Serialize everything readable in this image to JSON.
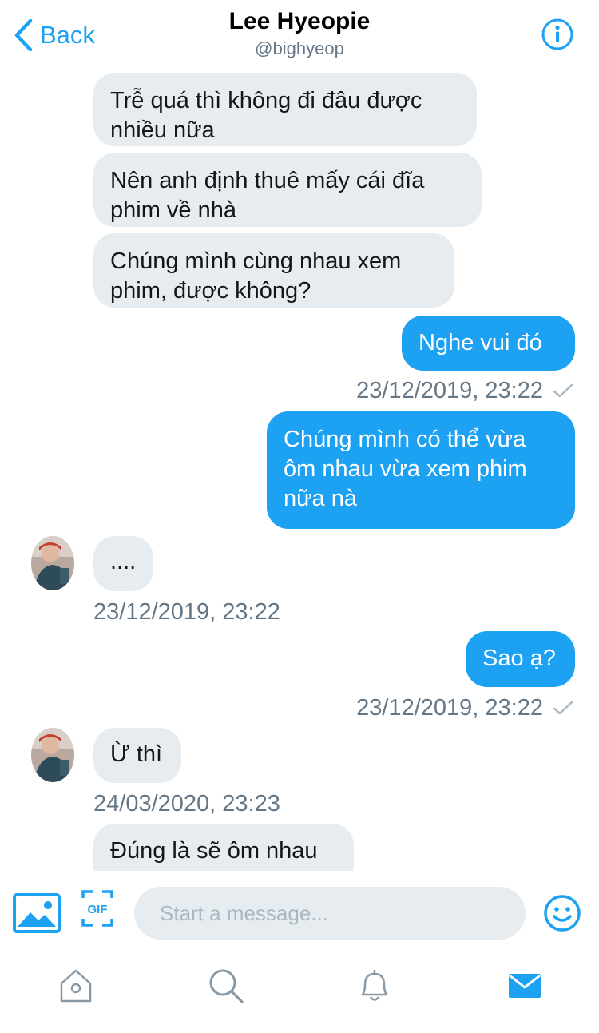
{
  "header": {
    "back_label": "Back",
    "title": "Lee Hyeopie",
    "handle": "@bighyeop",
    "info_icon": "info-icon"
  },
  "messages": [
    {
      "dir": "in",
      "text": "Trễ quá thì không đi đâu được nhiều nữa"
    },
    {
      "dir": "in",
      "text": "Nên anh định thuê mấy cái đĩa phim về nhà"
    },
    {
      "dir": "in",
      "text": "Chúng mình cùng nhau xem phim, được không?"
    },
    {
      "dir": "out",
      "text": "Nghe vui đó"
    },
    {
      "dir": "out",
      "timestamp": "23/12/2019, 23:22"
    },
    {
      "dir": "out",
      "text": "Chúng mình có thể vừa ôm nhau vừa xem phim nữa nà"
    },
    {
      "dir": "in",
      "text": "...."
    },
    {
      "dir": "in",
      "timestamp": "23/12/2019, 23:22"
    },
    {
      "dir": "out",
      "text": "Sao ạ?"
    },
    {
      "dir": "out",
      "timestamp": "23/12/2019, 23:22"
    },
    {
      "dir": "in",
      "text": "Ừ thì"
    },
    {
      "dir": "in",
      "timestamp": "24/03/2020, 23:23"
    },
    {
      "dir": "in",
      "text": "Đúng là sẽ ôm nhau"
    }
  ],
  "composer": {
    "placeholder": "Start a message...",
    "gif_label": "GIF",
    "icons": [
      "image-icon",
      "gif-icon",
      "emoji-icon"
    ]
  },
  "tabbar": {
    "tabs": [
      "home-icon",
      "search-icon",
      "notifications-icon",
      "messages-icon"
    ],
    "active": "messages-icon"
  },
  "colors": {
    "accent": "#1da1f2",
    "incoming_bubble": "#e6ecf0",
    "secondary_text": "#657786",
    "tab_inactive": "#8899a6"
  }
}
